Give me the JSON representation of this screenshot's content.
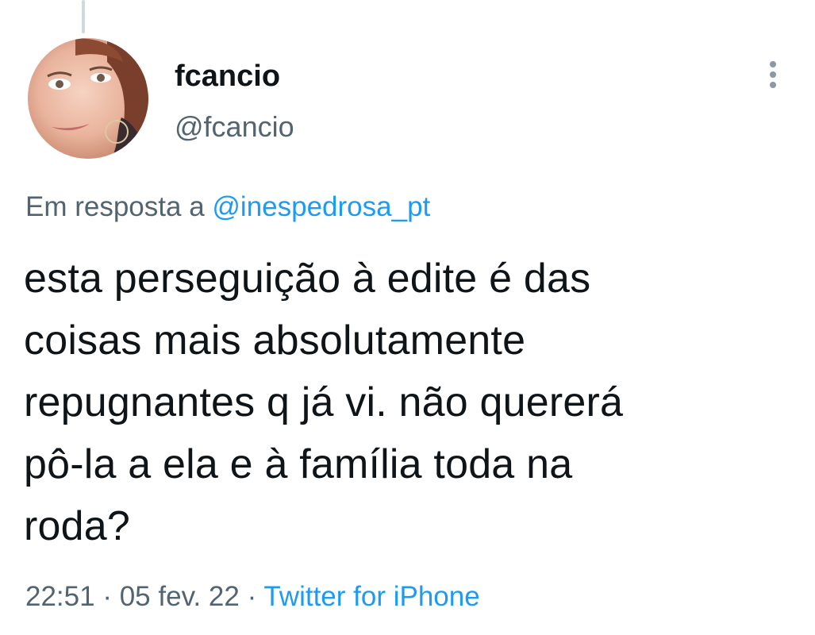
{
  "tweet": {
    "author": {
      "display_name": "fcancio",
      "handle": "@fcancio",
      "avatar": "user-avatar-photo"
    },
    "menu_icon": "more-vertical-icon",
    "reply": {
      "prefix": "Em resposta a",
      "mention": "@inespedrosa_pt"
    },
    "text_lines": [
      "esta perseguição à edite é das",
      "coisas mais absolutamente",
      "repugnantes q já vi. não quererá",
      "pô-la a ela e à família toda na",
      "roda?"
    ],
    "time": "22:51",
    "separator": "·",
    "date": "05 fev. 22",
    "source": "Twitter for iPhone"
  },
  "colors": {
    "text": "#0f1419",
    "secondary": "#536471",
    "link": "#1d9bf0",
    "thread_line": "#cfd9de"
  }
}
